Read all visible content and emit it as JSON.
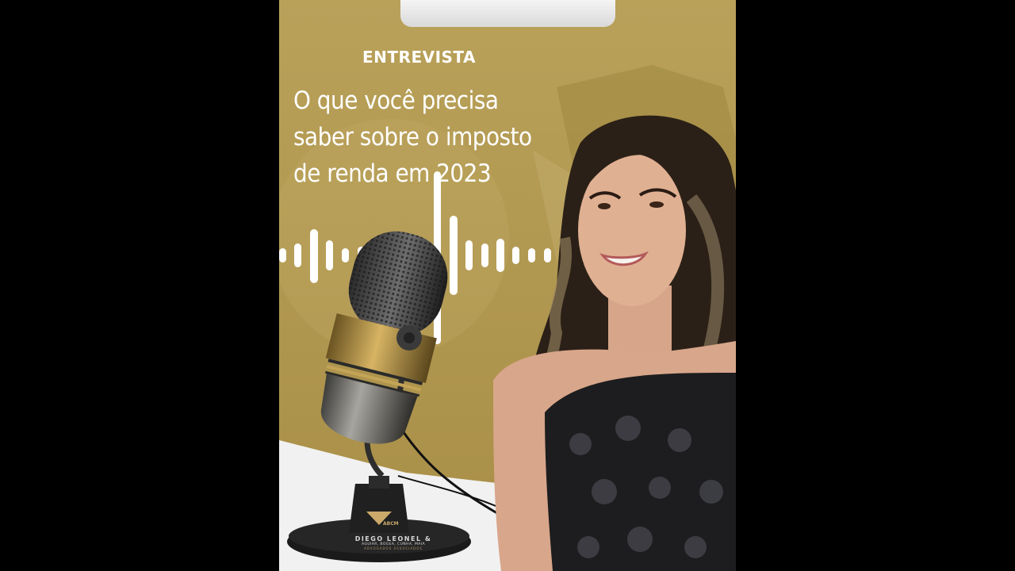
{
  "interview": {
    "eyebrow": "ENTREVISTA",
    "headline": "O que você precisa\nsaber sobre o imposto\nde renda em 2023"
  },
  "brand": {
    "badge": "ABCM",
    "name": "DIEGO LEONEL &",
    "partners": "AGUIAR, BOGEA, CUNHA, MAIA",
    "tagline": "ADVOGADOS ASSOCIADOS"
  },
  "colors": {
    "gold": "#b79f54",
    "letterbox": "#000000",
    "floor": "#f1f1f1"
  }
}
